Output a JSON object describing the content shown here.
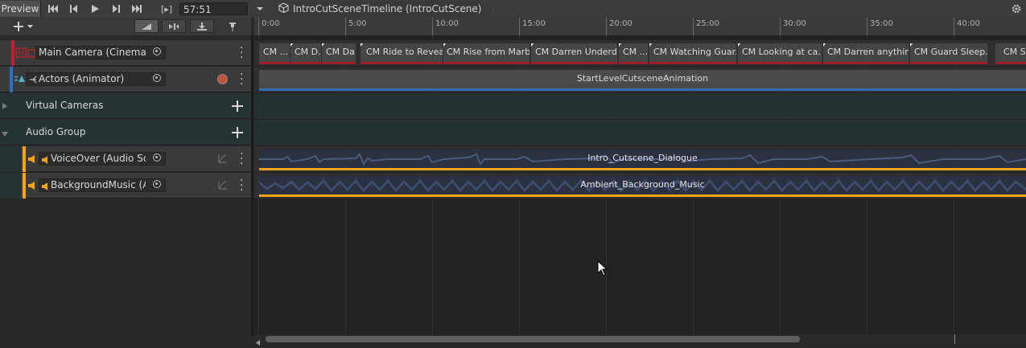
{
  "toolbar": {
    "preview_label": "Preview",
    "time_value": "57:51",
    "frame_mode_label": "[▸]",
    "breadcrumb": "IntroCutSceneTimeline (IntroCutScene)"
  },
  "ruler": {
    "labels": [
      "0:00",
      "5:00",
      "10:00",
      "15:00",
      "20:00",
      "25:00",
      "30:00",
      "35:00",
      "40:00"
    ]
  },
  "tracks": [
    {
      "name": "Main Camera (Cinemac",
      "color": "#b5222f",
      "type": "cinemachine"
    },
    {
      "name": "Actors (Animator)",
      "color": "#2e6fb8",
      "type": "animation"
    },
    {
      "name": "Virtual Cameras",
      "type": "group"
    },
    {
      "name": "Audio Group",
      "type": "group"
    },
    {
      "name": "VoiceOver (Audio Sou",
      "color": "#f1a417",
      "type": "audio"
    },
    {
      "name": "BackgroundMusic (A",
      "color": "#f1a417",
      "type": "audio"
    }
  ],
  "camera_clips": [
    "CM ...",
    "CM D...",
    "CM Da...",
    "CM Ride to Reveal",
    "CM Rise from Marb...",
    "CM Darren Underd...",
    "CM ...",
    "CM Watching Guar...",
    "CM Looking at ca...",
    "CM Darren anythin...",
    "CM Guard Sleep...",
    "CM Se"
  ],
  "animation_clip": "StartLevelCutsceneAnimation",
  "audio_clips": {
    "voiceover": "Intro_Cutscene_Dialogue",
    "music": "Ambient_Background_Music"
  },
  "colors": {
    "camera_track": "#b5222f",
    "animation_track": "#2e6fb8",
    "audio_track": "#f1a417"
  }
}
